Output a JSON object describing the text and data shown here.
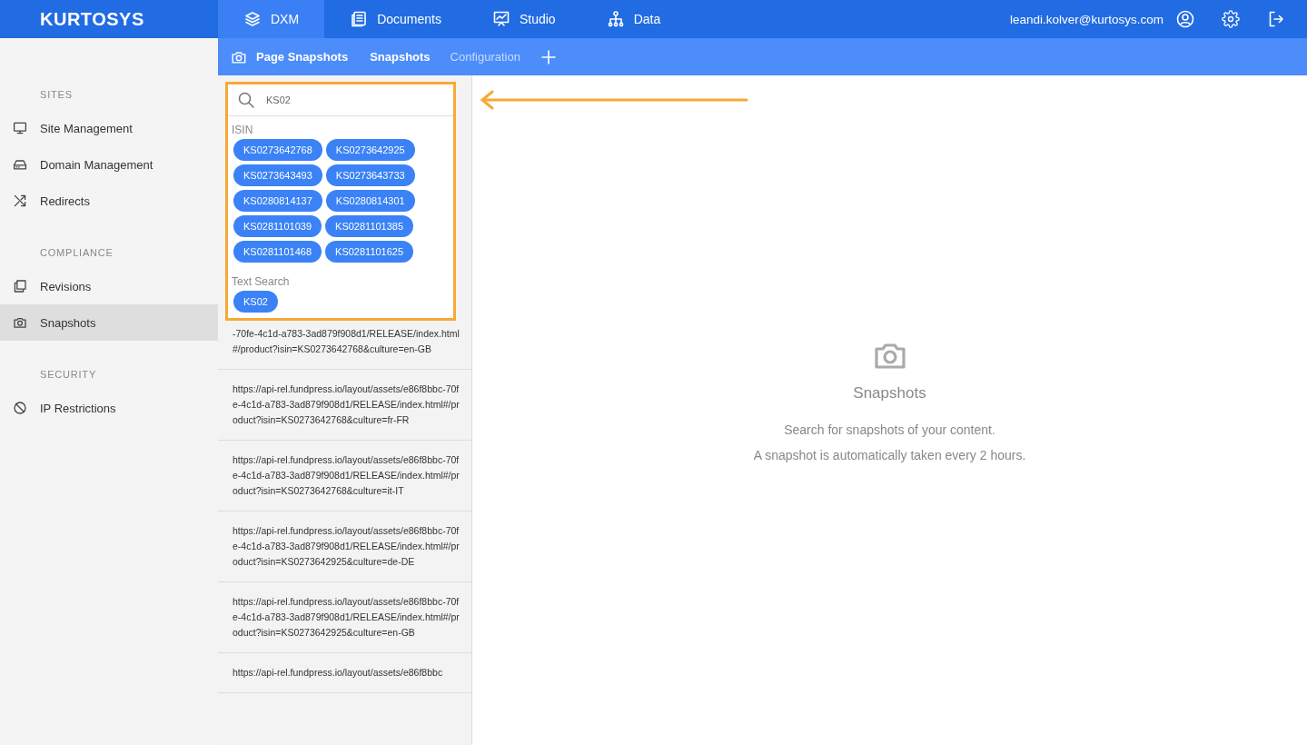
{
  "brand": "KURTOSYS",
  "nav": [
    {
      "label": "DXM",
      "selected": true
    },
    {
      "label": "Documents",
      "selected": false
    },
    {
      "label": "Studio",
      "selected": false
    },
    {
      "label": "Data",
      "selected": false
    }
  ],
  "user": {
    "email": "leandi.kolver@kurtosys.com"
  },
  "subnav": {
    "title": "Page Snapshots",
    "tabs": [
      {
        "label": "Snapshots",
        "selected": true
      },
      {
        "label": "Configuration",
        "selected": false
      }
    ]
  },
  "sidebar": {
    "sections": [
      {
        "heading": "SITES",
        "items": [
          {
            "label": "Site Management",
            "selected": false
          },
          {
            "label": "Domain Management",
            "selected": false
          },
          {
            "label": "Redirects",
            "selected": false
          }
        ]
      },
      {
        "heading": "COMPLIANCE",
        "items": [
          {
            "label": "Revisions",
            "selected": false
          },
          {
            "label": "Snapshots",
            "selected": true
          }
        ]
      },
      {
        "heading": "SECURITY",
        "items": [
          {
            "label": "IP Restrictions",
            "selected": false
          }
        ]
      }
    ]
  },
  "search": {
    "value": "KS02",
    "groups": [
      {
        "heading": "ISIN",
        "chips": [
          "KS0273642768",
          "KS0273642925",
          "KS0273643493",
          "KS0273643733",
          "KS0280814137",
          "KS0280814301",
          "KS0281101039",
          "KS0281101385",
          "KS0281101468",
          "KS0281101625"
        ]
      },
      {
        "heading": "Text Search",
        "chips": [
          "KS02"
        ]
      }
    ]
  },
  "results": [
    "-70fe-4c1d-a783-3ad879f908d1/RELEASE/index.html#/product?isin=KS0273642768&culture=en-GB",
    "https://api-rel.fundpress.io/layout/assets/e86f8bbc-70fe-4c1d-a783-3ad879f908d1/RELEASE/index.html#/product?isin=KS0273642768&culture=fr-FR",
    "https://api-rel.fundpress.io/layout/assets/e86f8bbc-70fe-4c1d-a783-3ad879f908d1/RELEASE/index.html#/product?isin=KS0273642768&culture=it-IT",
    "https://api-rel.fundpress.io/layout/assets/e86f8bbc-70fe-4c1d-a783-3ad879f908d1/RELEASE/index.html#/product?isin=KS0273642925&culture=de-DE",
    "https://api-rel.fundpress.io/layout/assets/e86f8bbc-70fe-4c1d-a783-3ad879f908d1/RELEASE/index.html#/product?isin=KS0273642925&culture=en-GB",
    "https://api-rel.fundpress.io/layout/assets/e86f8bbc"
  ],
  "empty_state": {
    "title": "Snapshots",
    "lines": [
      "Search for snapshots of your content.",
      "A snapshot is automatically taken every 2 hours."
    ]
  }
}
